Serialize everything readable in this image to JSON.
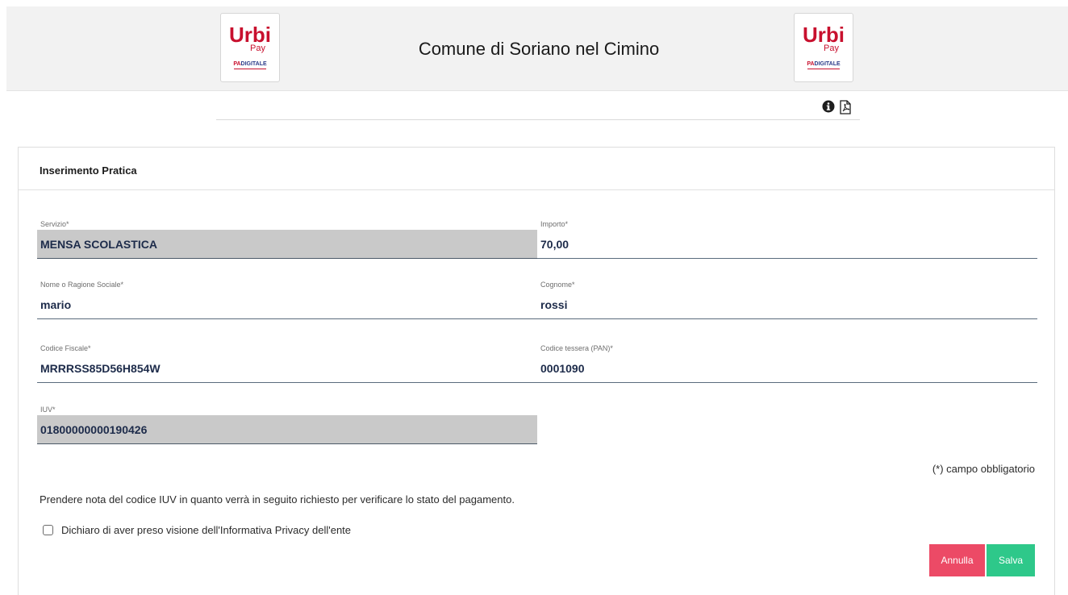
{
  "header": {
    "title": "Comune di Soriano nel Cimino",
    "logo": {
      "brand": "Urbi",
      "sub": "Pay",
      "tagline_pa": "PA",
      "tagline_rest": "DIGITALE"
    }
  },
  "toolbar": {
    "icons": [
      "info-circle-icon",
      "pdf-file-icon"
    ]
  },
  "form": {
    "title": "Inserimento Pratica",
    "fields": {
      "servizio": {
        "label": "Servizio*",
        "value": "MENSA SCOLASTICA"
      },
      "importo": {
        "label": "Importo*",
        "value": "70,00"
      },
      "nome": {
        "label": "Nome o Ragione Sociale*",
        "value": "mario"
      },
      "cognome": {
        "label": "Cognome*",
        "value": "rossi"
      },
      "codice_fiscale": {
        "label": "Codice Fiscale*",
        "value": "MRRRSS85D56H854W"
      },
      "codice_tessera": {
        "label": "Codice tessera (PAN)*",
        "value": "0001090"
      },
      "iuv": {
        "label": "IUV*",
        "value": "01800000000190426"
      }
    },
    "required_note": "(*) campo obbligatorio",
    "iuv_note": "Prendere nota del codice IUV in quanto verrà in seguito richiesto per verificare lo stato del pagamento.",
    "privacy_label": "Dichiaro di aver preso visione dell'Informativa Privacy dell'ente",
    "privacy_checked": false,
    "buttons": {
      "cancel": "Annulla",
      "save": "Salva"
    }
  },
  "colors": {
    "cancel": "#ec4a66",
    "save": "#2ec88a",
    "brand_red": "#c8102e",
    "brand_blue": "#2a3a88"
  }
}
